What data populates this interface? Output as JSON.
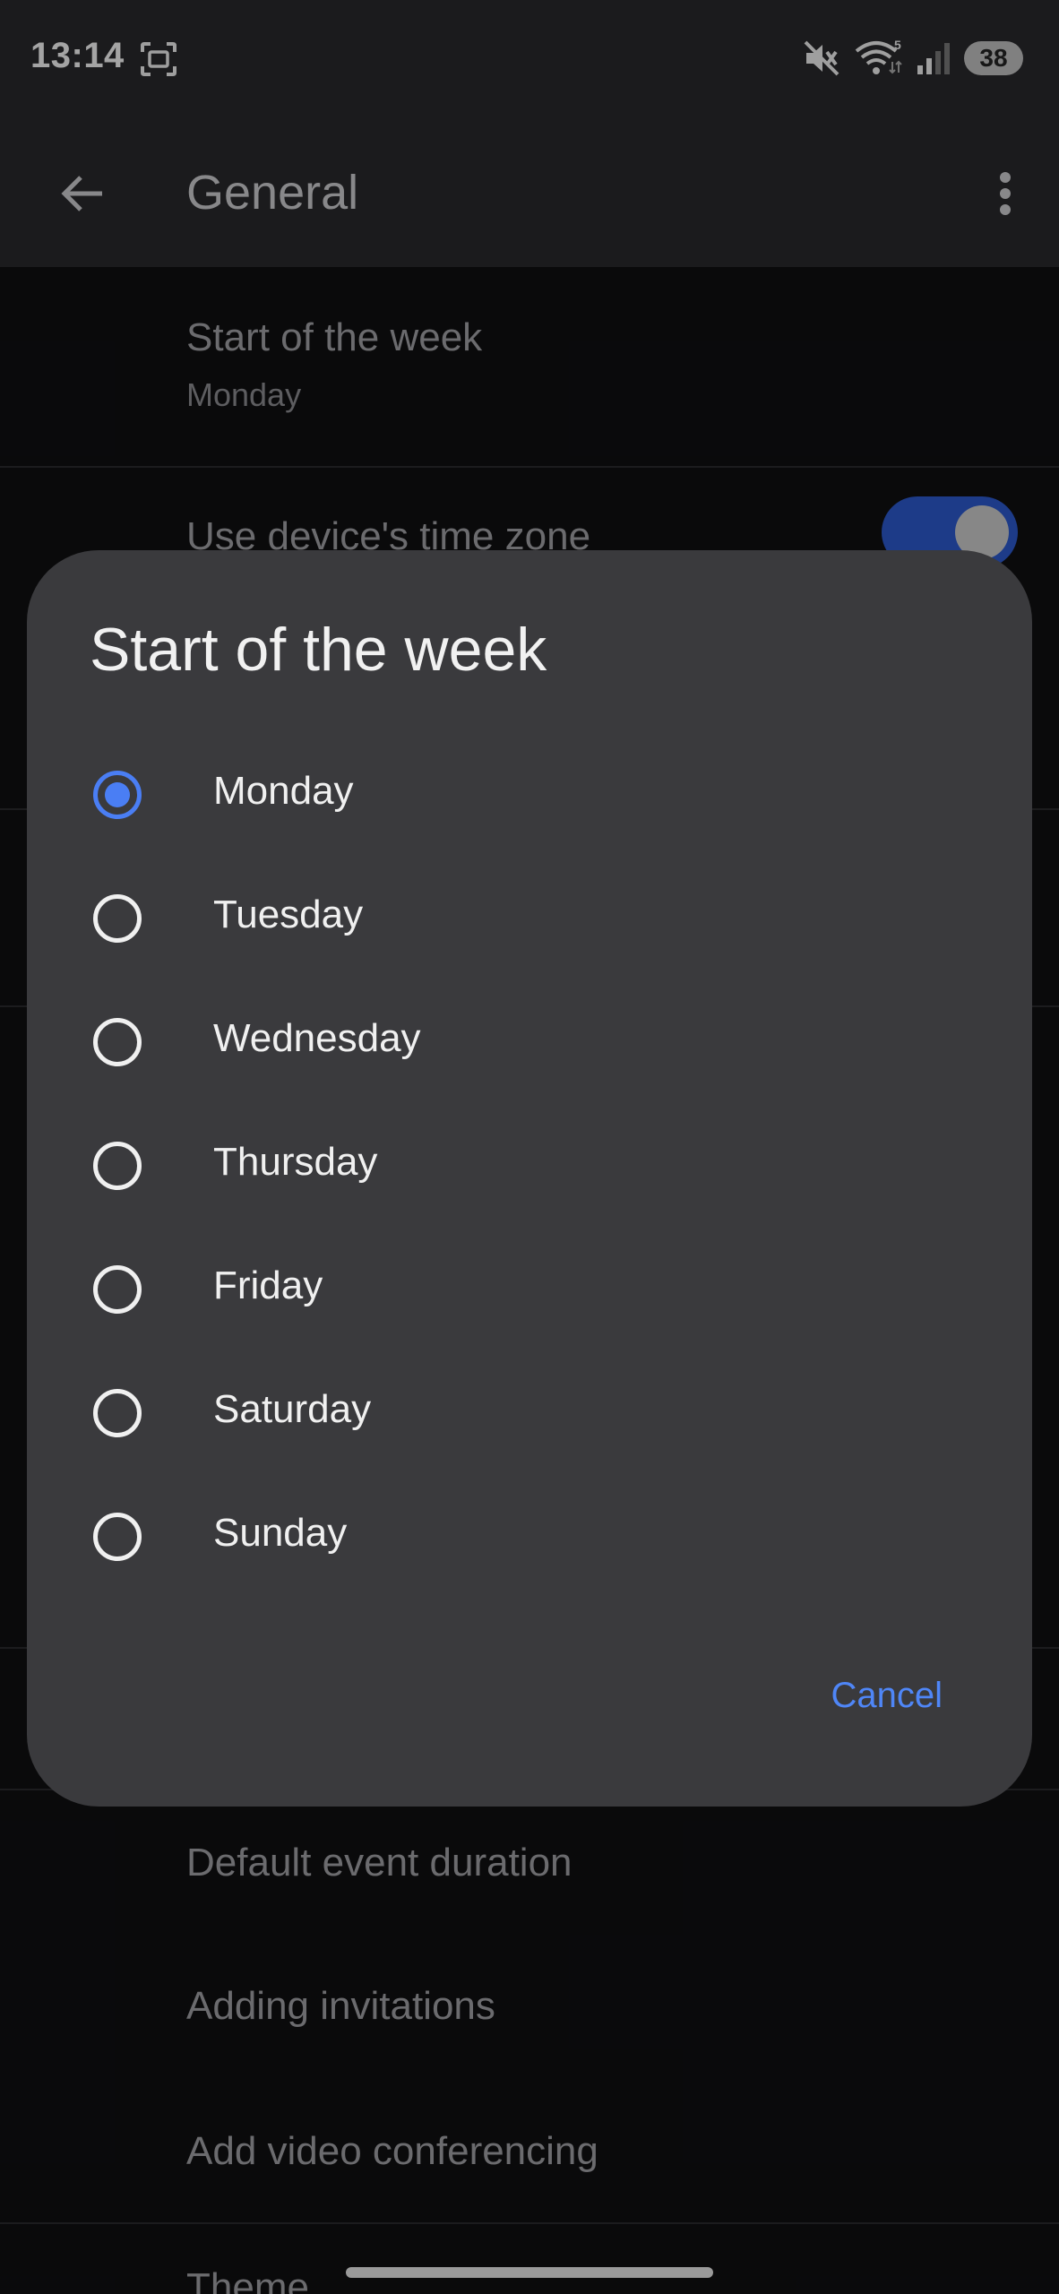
{
  "status_bar": {
    "time": "13:14",
    "battery": "38",
    "icons": [
      "screenshot-icon",
      "mute-icon",
      "wifi-icon",
      "signal-icon"
    ]
  },
  "app_bar": {
    "title": "General",
    "back_icon": "arrow-left-icon",
    "overflow_icon": "more-vert-icon"
  },
  "settings": {
    "start_of_week": {
      "title": "Start of the week",
      "value": "Monday"
    },
    "device_time_zone": {
      "title": "Use device's time zone",
      "enabled": true
    },
    "default_event_duration": {
      "title": "Default event duration"
    },
    "adding_invitations": {
      "title": "Adding invitations"
    },
    "video_conferencing": {
      "title": "Add video conferencing"
    },
    "theme": {
      "title": "Theme"
    }
  },
  "dialog": {
    "title": "Start of the week",
    "selected": "Monday",
    "options": [
      "Monday",
      "Tuesday",
      "Wednesday",
      "Thursday",
      "Friday",
      "Saturday",
      "Sunday"
    ],
    "cancel_label": "Cancel"
  },
  "colors": {
    "accent": "#4a7ef4",
    "toggle_track": "#2b58c9",
    "dialog_bg": "#3a3a3d",
    "app_bar_bg": "#28282b",
    "page_bg": "#0f0f11"
  }
}
